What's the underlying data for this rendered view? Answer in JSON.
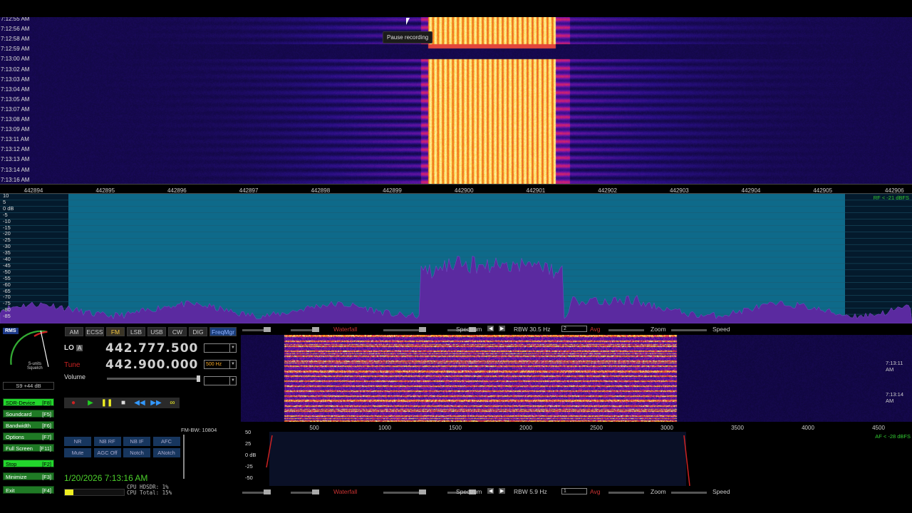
{
  "top_waterfall": {
    "time_labels": [
      "7:12:55 AM",
      "7:12:56 AM",
      "7:12:58 AM",
      "7:12:59 AM",
      "7:13:00 AM",
      "7:13:02 AM",
      "7:13:03 AM",
      "7:13:04 AM",
      "7:13:05 AM",
      "7:13:07 AM",
      "7:13:08 AM",
      "7:13:09 AM",
      "7:13:11 AM",
      "7:13:12 AM",
      "7:13:13 AM",
      "7:13:14 AM",
      "7:13:16 AM"
    ],
    "tooltip": "Pause recording"
  },
  "freq_axis": [
    "442894",
    "442895",
    "442896",
    "442897",
    "442898",
    "442899",
    "442900",
    "442901",
    "442902",
    "442903",
    "442904",
    "442905",
    "442906"
  ],
  "spectrum": {
    "db_labels": [
      "10",
      "5",
      "0 dB",
      "-5",
      "-10",
      "-15",
      "-20",
      "-25",
      "-30",
      "-35",
      "-40",
      "-45",
      "-50",
      "-55",
      "-60",
      "-65",
      "-70",
      "-75",
      "-80",
      "-85"
    ],
    "rf_info": "RF < -21 dBFS"
  },
  "smeter": {
    "rms": "RMS",
    "scale_text": "S-units\nSquelch",
    "value": "S9 +44 dB"
  },
  "side_buttons": [
    {
      "label": "SDR-Device",
      "key": "[F8]",
      "lit": true
    },
    {
      "label": "Soundcard",
      "key": "[F5]",
      "lit": false
    },
    {
      "label": "Bandwidth",
      "key": "[F6]",
      "lit": false
    },
    {
      "label": "Options",
      "key": "[F7]",
      "lit": false
    },
    {
      "label": "Full Screen",
      "key": "[F11]",
      "lit": false
    },
    {
      "label": "Stop",
      "key": "[F2]",
      "lit": true
    },
    {
      "label": "Minimize",
      "key": "[F3]",
      "lit": false
    },
    {
      "label": "Exit",
      "key": "[F4]",
      "lit": false
    }
  ],
  "modes": [
    "AM",
    "ECSS",
    "FM",
    "LSB",
    "USB",
    "CW",
    "DIG",
    "FreqMgr"
  ],
  "lo": {
    "label": "LO",
    "badge": "A",
    "freq": "442.777.500"
  },
  "tune": {
    "label": "Tune",
    "freq": "442.900.000",
    "step": "500 Hz"
  },
  "volume_label": "Volume",
  "fm_bw": "FM-BW: 10804",
  "dsp_buttons_row1": [
    "NR",
    "NB RF",
    "NB IF",
    "AFC"
  ],
  "dsp_buttons_row2": [
    "Mute",
    "AGC Off",
    "Notch",
    "ANotch"
  ],
  "datetime": "1/20/2026 7:13:16 AM",
  "cpu": {
    "hdsdr": "CPU HDSDR:  1%",
    "total": "CPU Total: 15%"
  },
  "af_waterfall_times": [
    "7:13:11 AM",
    "7:13:14 AM"
  ],
  "af_axis": [
    "500",
    "1000",
    "1500",
    "2000",
    "2500",
    "3000",
    "3500",
    "4000",
    "4500"
  ],
  "af_spec": {
    "db_labels": [
      "50",
      "25",
      "0 dB",
      "-25",
      "-50"
    ],
    "info": "AF < -28 dBFS"
  },
  "ctrl_top": {
    "waterfall": "Waterfall",
    "spectrum": "Spectrum",
    "rbw": "RBW 30.5 Hz",
    "avg_val": "2",
    "avg": "Avg",
    "zoom": "Zoom",
    "speed": "Speed"
  },
  "ctrl_bot": {
    "waterfall": "Waterfall",
    "spectrum": "Spectrum",
    "rbw": "RBW  5.9 Hz",
    "avg_val": "1",
    "avg": "Avg",
    "zoom": "Zoom",
    "speed": "Speed"
  },
  "colors": {
    "green_btn": "#1f7a25",
    "green_lit": "#22d62c",
    "accent_red": "#cc2222",
    "spec_fill": "#041a2c",
    "signal": "#5b2aa0"
  }
}
